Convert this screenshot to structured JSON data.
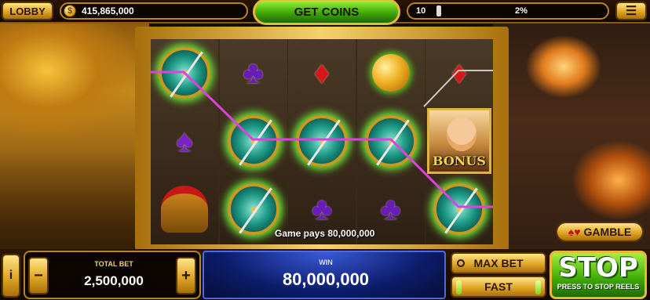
{
  "topbar": {
    "lobby_label": "LOBBY",
    "coin_icon": "coin-icon",
    "balance": "415,865,000",
    "get_coins_label": "GET COINS",
    "level": "10",
    "level_progress_percent": "2%",
    "menu_icon": "hamburger-menu-icon"
  },
  "reels": [
    [
      "shield",
      "spade",
      "helmet"
    ],
    [
      "club",
      "shield",
      "shield"
    ],
    [
      "diamond",
      "shield",
      "club"
    ],
    [
      "apple",
      "shield",
      "club"
    ],
    [
      "diamond",
      "bonus",
      "shield"
    ]
  ],
  "bonus_label": "BONUS",
  "win_message": "Game pays 80,000,000",
  "gamble_label": "GAMBLE",
  "bottom": {
    "info_label": "i",
    "minus_label": "−",
    "plus_label": "+",
    "total_bet_label": "TOTAL BET",
    "total_bet": "2,500,000",
    "win_label": "WIN",
    "win": "80,000,000",
    "max_bet_label": "MAX BET",
    "fast_label": "FAST",
    "stop_label": "STOP",
    "stop_sub": "PRESS TO STOP REELS"
  },
  "colors": {
    "payline": "#e040e0",
    "accent_gold": "#e0a624",
    "stop_green": "#44b008"
  }
}
